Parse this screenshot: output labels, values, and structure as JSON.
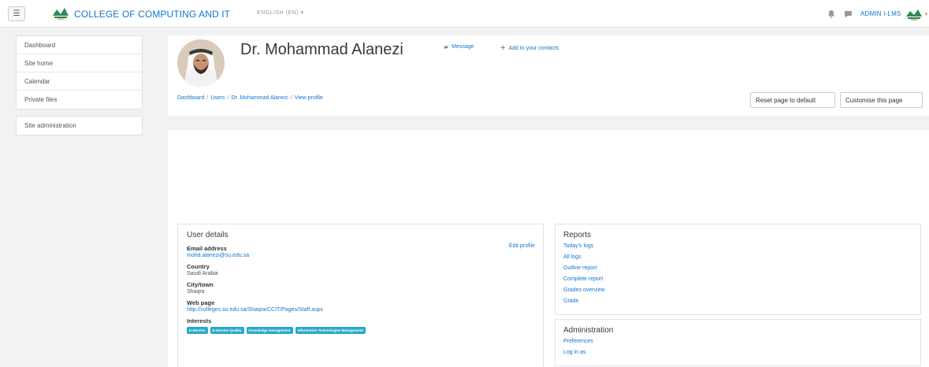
{
  "navbar": {
    "site_name": "COLLEGE OF COMPUTING AND IT",
    "language": "ENGLISH (EN) ▾",
    "user_name": "ADMIN I-LMS",
    "menu_icon": "hamburger-icon",
    "notification_icon": "bell-icon",
    "messages_icon": "chat-icon"
  },
  "sidebar": {
    "main_items": [
      {
        "label": "Dashboard"
      },
      {
        "label": "Site home"
      },
      {
        "label": "Calendar"
      },
      {
        "label": "Private files"
      }
    ],
    "admin_items": [
      {
        "label": "Site administration"
      }
    ]
  },
  "header": {
    "profile_name": "Dr. Mohammad Alanezi",
    "message_label": "Message",
    "add_contact_label": "Add to your contacts",
    "breadcrumb": [
      "Dashboard",
      "Users",
      "Dr. Mohammad Alanezi",
      "View profile"
    ],
    "reset_label": "Reset page to default",
    "customise_label": "Customise this page"
  },
  "user_details": {
    "title": "User details",
    "edit_label": "Edit profile",
    "email_label": "Email address",
    "email": "mohd.alanezi@su.edu.sa",
    "country_label": "Country",
    "country": "Saudi Arabia",
    "city_label": "City/town",
    "city": "Shaqra",
    "web_label": "Web page",
    "web": "http://colleges.su.edu.sa/Shaqra/CCIT/Pages/Staff.aspx",
    "interests_label": "Interests",
    "interests": [
      "E-Service",
      "E-Service Quality",
      "Knowledge management",
      "Information Technologies Management"
    ]
  },
  "reports": {
    "title": "Reports",
    "links": [
      "Today's logs",
      "All logs",
      "Outline report",
      "Complete report",
      "Grades overview",
      "Grade"
    ]
  },
  "administration": {
    "title": "Administration",
    "links": [
      "Preferences",
      "Log in as"
    ]
  },
  "colors": {
    "link": "#1177d1",
    "tag": "#2ba8c8"
  }
}
